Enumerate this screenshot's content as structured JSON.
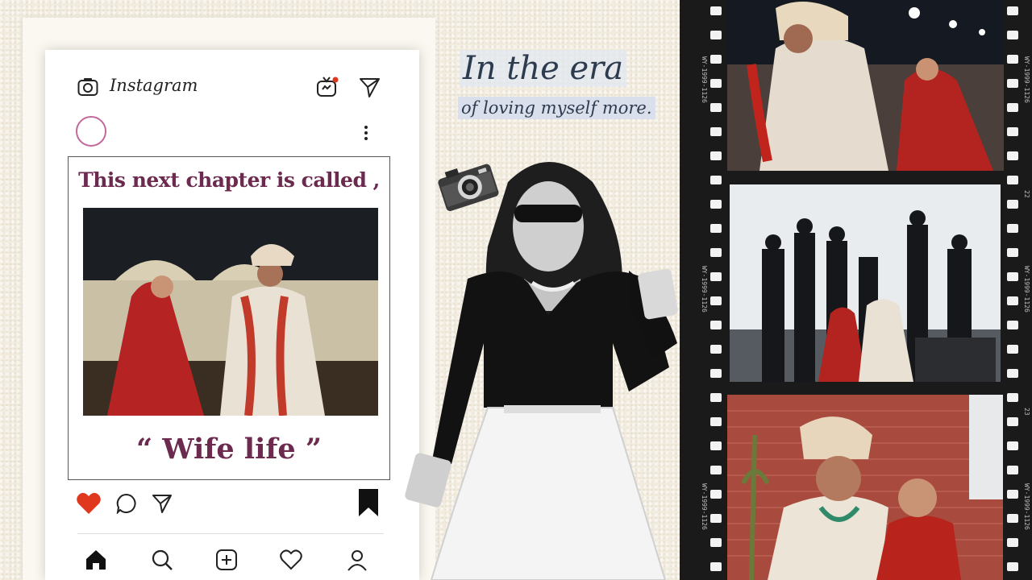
{
  "instagram": {
    "wordmark": "Instagram",
    "post_headline": "This next chapter is called ,",
    "post_caption": "“ Wife life ”"
  },
  "tagline": {
    "line1": "In the era",
    "line2": "of loving myself more."
  },
  "film": {
    "edge_code": "WY-1999-1126",
    "frame_number_a": "22",
    "frame_number_b": "23"
  },
  "icons": {
    "camera": "camera-icon",
    "tv": "igtv-icon",
    "send": "send-icon",
    "more": "more-icon",
    "heart": "heart-icon",
    "comment": "comment-icon",
    "share": "share-icon",
    "bookmark": "bookmark-icon",
    "home": "home-icon",
    "search": "search-icon",
    "add": "add-post-icon",
    "activity": "heart-outline-icon",
    "profile": "profile-icon"
  },
  "colors": {
    "headline": "#6b2a4e",
    "like": "#e0371f",
    "tagline": "#2d3b4f",
    "film": "#1a1a1a"
  }
}
